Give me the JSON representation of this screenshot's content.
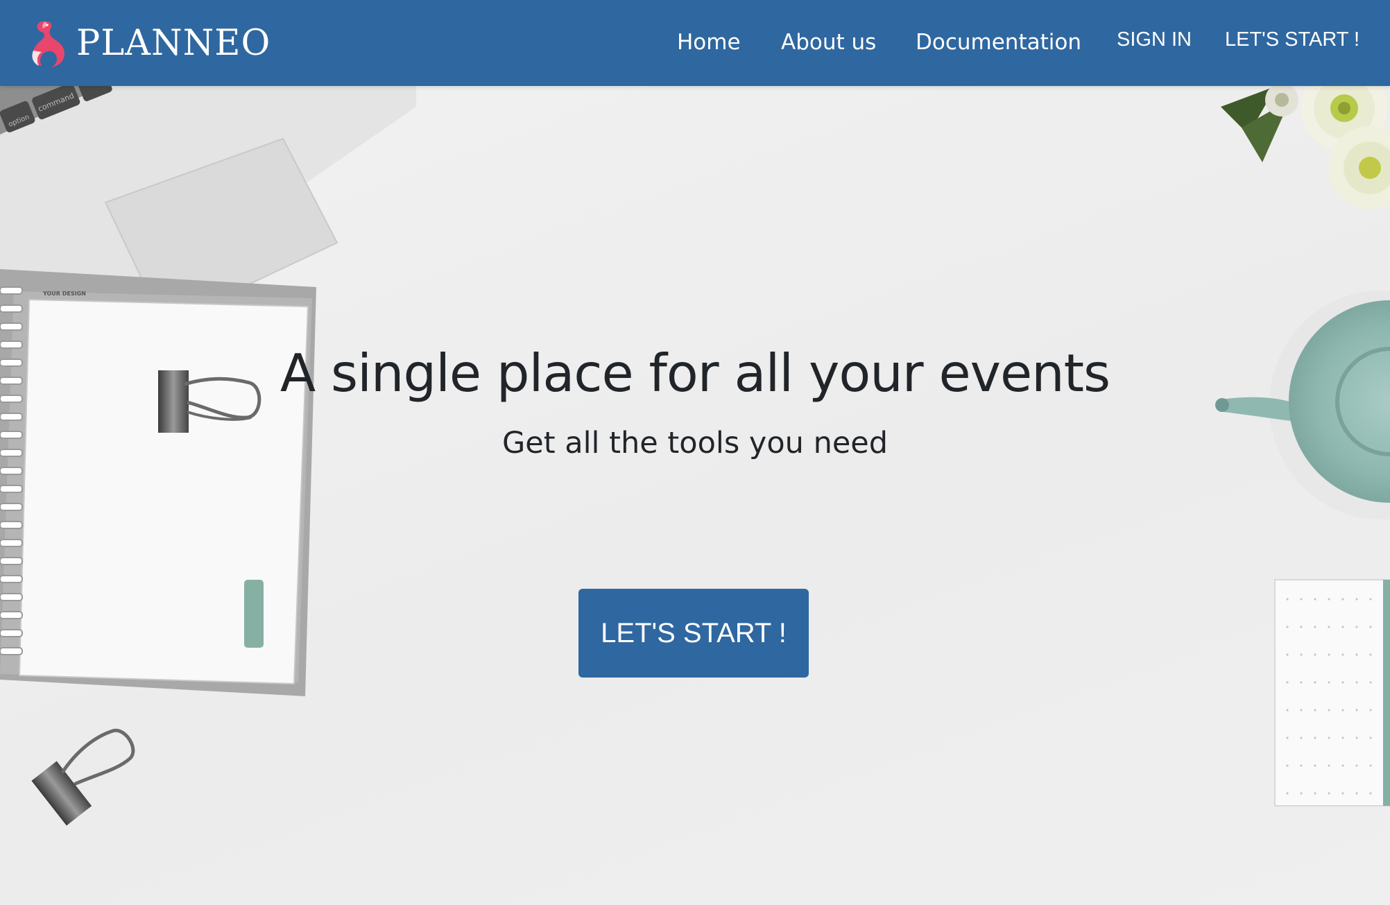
{
  "navbar": {
    "brand_name": "PLANNEO",
    "links": [
      {
        "label": "Home"
      },
      {
        "label": "About us"
      },
      {
        "label": "Documentation"
      },
      {
        "label": "SIGN IN"
      },
      {
        "label": "LET'S START !"
      }
    ],
    "background_color": "#2f67a0"
  },
  "hero": {
    "title": "A single place for all your events",
    "subtitle": "Get all the tools you need",
    "cta_label": "LET'S START !",
    "notebook_caption": "YOUR DESIGN",
    "keyboard_keys": [
      "option",
      "command"
    ]
  },
  "colors": {
    "accent": "#2f67a0",
    "text": "#212529",
    "background": "#efefef",
    "logo_pink": "#e8466d"
  }
}
